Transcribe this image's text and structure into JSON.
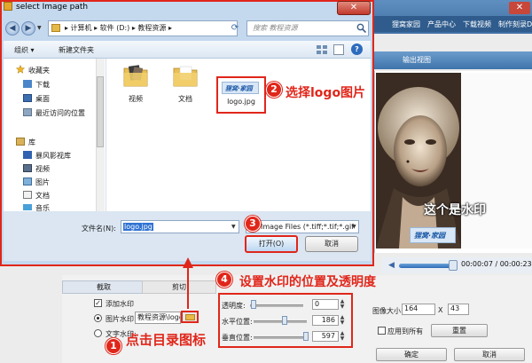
{
  "dialog": {
    "title": "select Image path",
    "close_glyph": "✕",
    "address_path": "▸ 计算机 ▸ 软件 (D:) ▸ 教程资源 ▸",
    "search_placeholder": "搜索 教程资源",
    "toolbar": {
      "organize": "组织 ▾",
      "new_folder": "新建文件夹"
    },
    "nav": {
      "favorites": "收藏夹",
      "items": [
        "下载",
        "桌面",
        "最近访问的位置"
      ],
      "library": "库",
      "lib_items": [
        "暴风影视库",
        "视频",
        "图片",
        "文档",
        "音乐"
      ]
    },
    "files": [
      {
        "name": "视频",
        "icon": "folder-video-icon"
      },
      {
        "name": "文档",
        "icon": "folder-icon"
      },
      {
        "name": "logo.jpg",
        "icon": "image-file-icon"
      }
    ],
    "logo_thumb_text": "狸窝·家园",
    "filename_label": "文件名(N):",
    "filename_value": "logo.jpg",
    "filetype_value": "Image Files (*.tiff;*.tif;*.gif",
    "open_button": "打开(O)",
    "cancel_button": "取消"
  },
  "app": {
    "close_glyph": "✕",
    "menu": [
      "狸窝家园",
      "产品中心",
      "下载视频",
      "制作刻录DVD"
    ],
    "output_tab": "输出视图",
    "player_time": "00:00:07 / 00:00:23",
    "tabs": [
      "截取",
      "剪切"
    ],
    "add_watermark": "添加水印",
    "image_watermark": "图片水印:",
    "image_path": "教程资源\\logo.",
    "text_watermark": "文字水印:",
    "opacity_label": "透明度:",
    "opacity_value": "0",
    "hpos_label": "水平位置:",
    "hpos_value": "186",
    "vpos_label": "垂直位置:",
    "vpos_value": "597",
    "size_label": "图像大小:",
    "size_w": "164",
    "size_x": "X",
    "size_h": "43",
    "apply_all": "应用到所有",
    "reset_button": "重置",
    "ok_button": "确定",
    "cancel_button": "取消"
  },
  "annotations": {
    "step1": {
      "num": "1",
      "text": "点击目录图标"
    },
    "step2": {
      "num": "2",
      "text": "选择logo图片"
    },
    "step3": {
      "num": "3"
    },
    "step4": {
      "num": "4",
      "text": "设置水印的位置及透明度"
    },
    "watermark_note": "这个是水印"
  },
  "colors": {
    "annotation_red": "#e0261a",
    "title_blue": "#c4d8ee",
    "selection_blue": "#3072d3"
  }
}
